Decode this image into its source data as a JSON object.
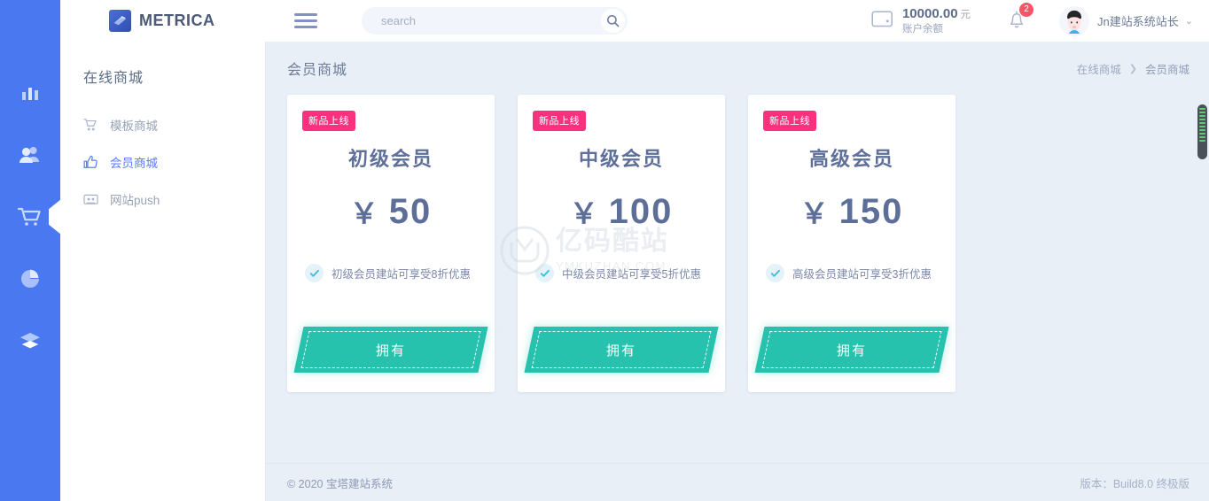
{
  "brand": {
    "name": "METRICA",
    "logo_icon": "metrica-logo-icon"
  },
  "topbar": {
    "menu_icon": "hamburger-icon",
    "search": {
      "placeholder": "search",
      "value": "",
      "icon": "search-icon"
    },
    "wallet": {
      "icon": "wallet-icon",
      "amount": "10000.00",
      "unit": "元",
      "label": "账户余额"
    },
    "notifications": {
      "icon": "bell-icon",
      "count": "2"
    },
    "user": {
      "avatar_icon": "avatar-icon",
      "name": "Jn建站系统站长",
      "caret_icon": "chevron-down-icon"
    }
  },
  "rail": {
    "items": [
      {
        "icon": "bar-chart-icon",
        "active": false
      },
      {
        "icon": "users-icon",
        "active": false
      },
      {
        "icon": "shopping-cart-icon",
        "active": true
      },
      {
        "icon": "pie-chart-icon",
        "active": false
      },
      {
        "icon": "layers-icon",
        "active": false
      }
    ]
  },
  "sidebar": {
    "title": "在线商城",
    "items": [
      {
        "icon": "cart-outline-icon",
        "label": "模板商城",
        "active": false
      },
      {
        "icon": "thumbs-up-icon",
        "label": "会员商城",
        "active": true
      },
      {
        "icon": "push-icon",
        "label": "网站push",
        "active": false
      }
    ]
  },
  "page": {
    "title": "会员商城",
    "breadcrumb": {
      "parent": "在线商城",
      "separator": "❯",
      "current": "会员商城"
    }
  },
  "cards": [
    {
      "ribbon": "新品上线",
      "title": "初级会员",
      "currency": "￥",
      "price": "50",
      "feature": "初级会员建站可享受8折优惠",
      "check_icon": "check-icon",
      "button": "拥有"
    },
    {
      "ribbon": "新品上线",
      "title": "中级会员",
      "currency": "￥",
      "price": "100",
      "feature": "中级会员建站可享受5折优惠",
      "check_icon": "check-icon",
      "button": "拥有"
    },
    {
      "ribbon": "新品上线",
      "title": "高级会员",
      "currency": "￥",
      "price": "150",
      "feature": "高级会员建站可享受3折优惠",
      "check_icon": "check-icon",
      "button": "拥有"
    }
  ],
  "watermark": {
    "logo_icon": "ym-watermark-icon",
    "cn": "亿码酷站",
    "en": "YMKUZHAN.COM"
  },
  "footer": {
    "left": "© 2020 宝塔建站系统",
    "right": "版本：Build8.0 终极版"
  },
  "colors": {
    "rail": "#4a78f0",
    "accent_blue": "#5b7cfa",
    "teal_button": "#27c2ae",
    "ribbon_pink": "#f9317f",
    "badge_red": "#f4556b",
    "content_bg": "#e9eff7"
  }
}
